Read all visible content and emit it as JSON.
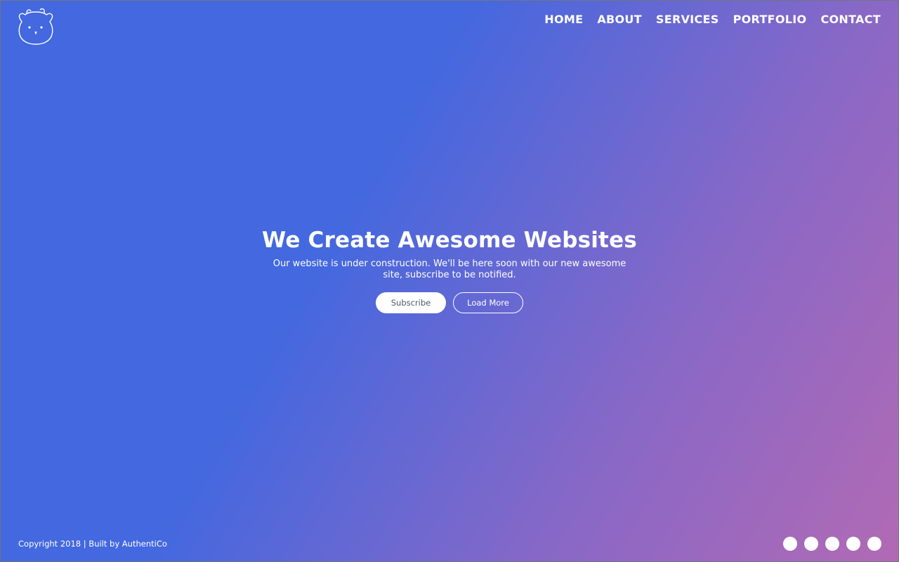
{
  "nav": {
    "items": [
      "HOME",
      "ABOUT",
      "SERVICES",
      "PORTFOLIO",
      "CONTACT"
    ]
  },
  "hero": {
    "title": "We Create Awesome Websites",
    "subtitle": "Our website is under construction. We'll be here soon with our new awesome site, subscribe to be notified.",
    "subscribe_label": "Subscribe",
    "load_more_label": "Load More"
  },
  "footer": {
    "copyright": "Copyright 2018 | Built by AuthentiCo",
    "social_icons": [
      "social-icon-1",
      "social-icon-2",
      "social-icon-3",
      "social-icon-4",
      "social-icon-5"
    ]
  },
  "colors": {
    "gradient_start": "#4368df",
    "gradient_end": "#b16ab4",
    "text": "#ffffff"
  }
}
